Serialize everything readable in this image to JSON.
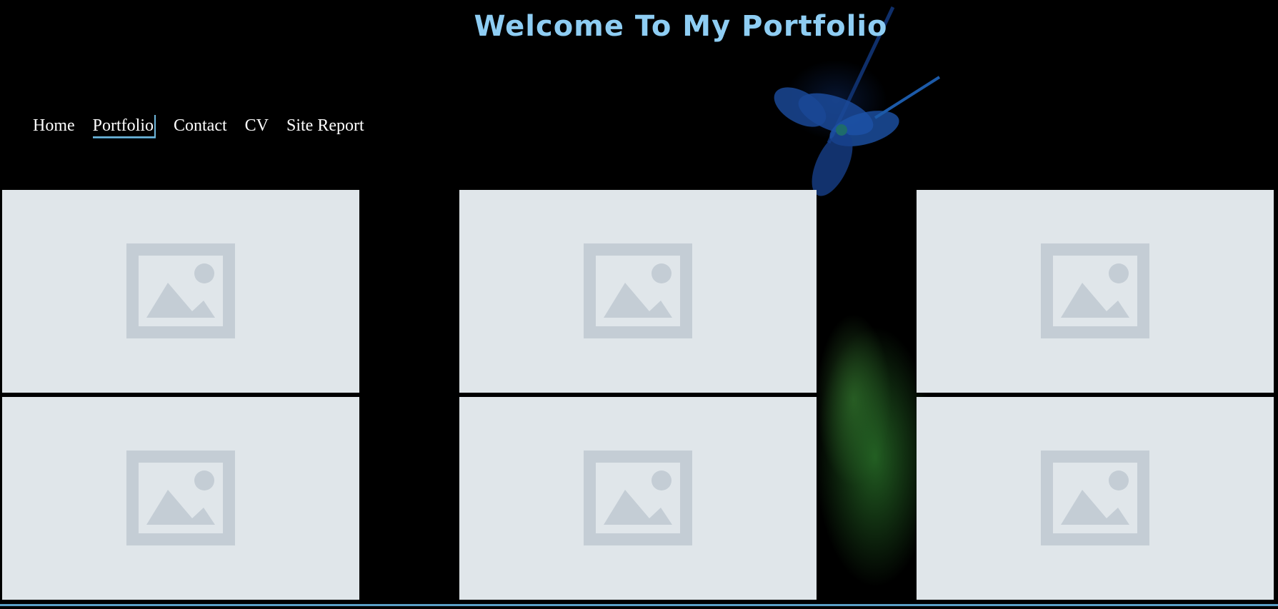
{
  "header": {
    "title": "Welcome To My Portfolio"
  },
  "nav": {
    "items": [
      {
        "label": "Home",
        "active": false
      },
      {
        "label": "Portfolio",
        "active": true
      },
      {
        "label": "Contact",
        "active": false
      },
      {
        "label": "CV",
        "active": false
      },
      {
        "label": "Site Report",
        "active": false
      }
    ]
  },
  "gallery": {
    "images": [
      {
        "icon": "image-placeholder-icon"
      },
      {
        "icon": "image-placeholder-icon"
      },
      {
        "icon": "image-placeholder-icon"
      },
      {
        "icon": "image-placeholder-icon"
      },
      {
        "icon": "image-placeholder-icon"
      },
      {
        "icon": "image-placeholder-icon"
      }
    ]
  },
  "colors": {
    "background": "#000000",
    "title": "#8ecdf3",
    "nav_text": "#ffffff",
    "active_underline": "#6fb7dc",
    "placeholder_bg": "#e0e6ea",
    "placeholder_icon": "#c4cdd5"
  }
}
